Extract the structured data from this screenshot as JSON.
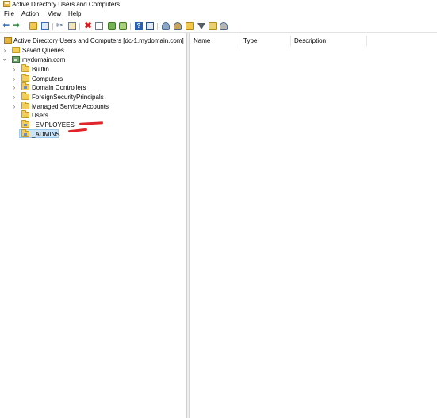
{
  "window": {
    "title": "Active Directory Users and Computers"
  },
  "menu": [
    "File",
    "Action",
    "View",
    "Help"
  ],
  "toolbar": {
    "icons": [
      "back-arrow-icon",
      "forward-arrow-icon",
      "up-folder-icon",
      "show-hide-tree-icon",
      "cut-icon",
      "copy-icon",
      "delete-icon",
      "properties-icon",
      "refresh-icon",
      "export-list-icon",
      "help-icon",
      "console-icon",
      "new-user-icon",
      "new-group-icon",
      "new-ou-icon",
      "filter-icon",
      "find-icon",
      "add-to-group-icon"
    ]
  },
  "tree": {
    "root": "Active Directory Users and Computers [dc-1.mydomain.com]",
    "saved_queries": "Saved Queries",
    "domain": "mydomain.com",
    "items": [
      {
        "label": "Builtin"
      },
      {
        "label": "Computers"
      },
      {
        "label": "Domain Controllers"
      },
      {
        "label": "ForeignSecurityPrincipals"
      },
      {
        "label": "Managed Service Accounts"
      },
      {
        "label": "Users"
      },
      {
        "label": "_EMPLOYEES"
      },
      {
        "label": "_ADMINS"
      }
    ],
    "selected": "_ADMINS"
  },
  "list": {
    "columns": [
      "Name",
      "Type",
      "Description"
    ]
  },
  "colors": {
    "selection_bg": "#cce4f7",
    "annotation": "#e0242b",
    "folder": "#f3cd5a"
  }
}
